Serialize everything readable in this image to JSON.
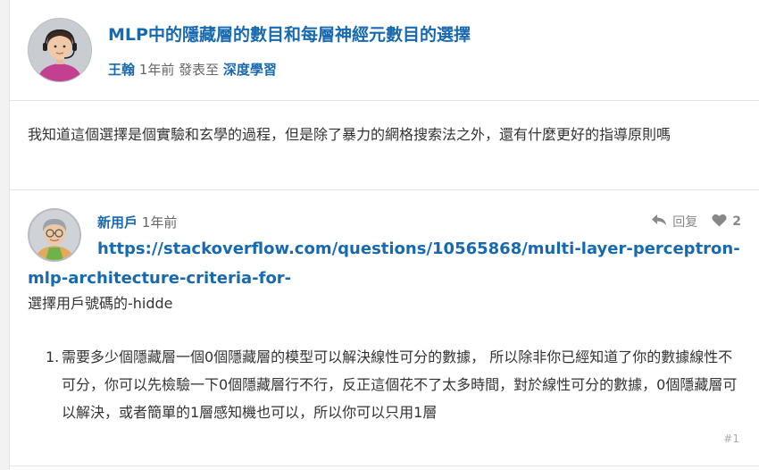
{
  "topic": {
    "title": "MLP中的隱藏層的數目和每層神經元數目的選擇",
    "author": "王翰",
    "time": "1年前",
    "posted_in_label": "發表至",
    "category": "深度學習"
  },
  "question": {
    "body": "我知道這個選擇是個實驗和玄學的過程，但是除了暴力的網格搜索法之外，還有什麼更好的指導原則嗎"
  },
  "reply": {
    "username": "新用戶",
    "time": "1年前",
    "reply_label": "回复",
    "likes": "2",
    "link": "https://stackoverflow.com/questions/10565868/multi-layer-perceptron-mlp-architecture-criteria-for-",
    "plain": "選擇用戶號碼的-hidde",
    "list_number": "1.",
    "list_text": "需要多少個隱藏層一個0個隱藏層的模型可以解決線性可分的數據， 所以除非你已經知道了你的數據線性不可分，你可以先檢驗一下0個隱藏層行不行，反正這個花不了太多時間，對於線性可分的數據，0個隱藏層可以解決，或者簡單的1層感知機也可以，所以你可以只用1層",
    "post_number": "#1"
  },
  "colors": {
    "link_blue": "#1769b0",
    "text": "#333333",
    "muted": "#666666",
    "border": "#e3e3e3"
  }
}
